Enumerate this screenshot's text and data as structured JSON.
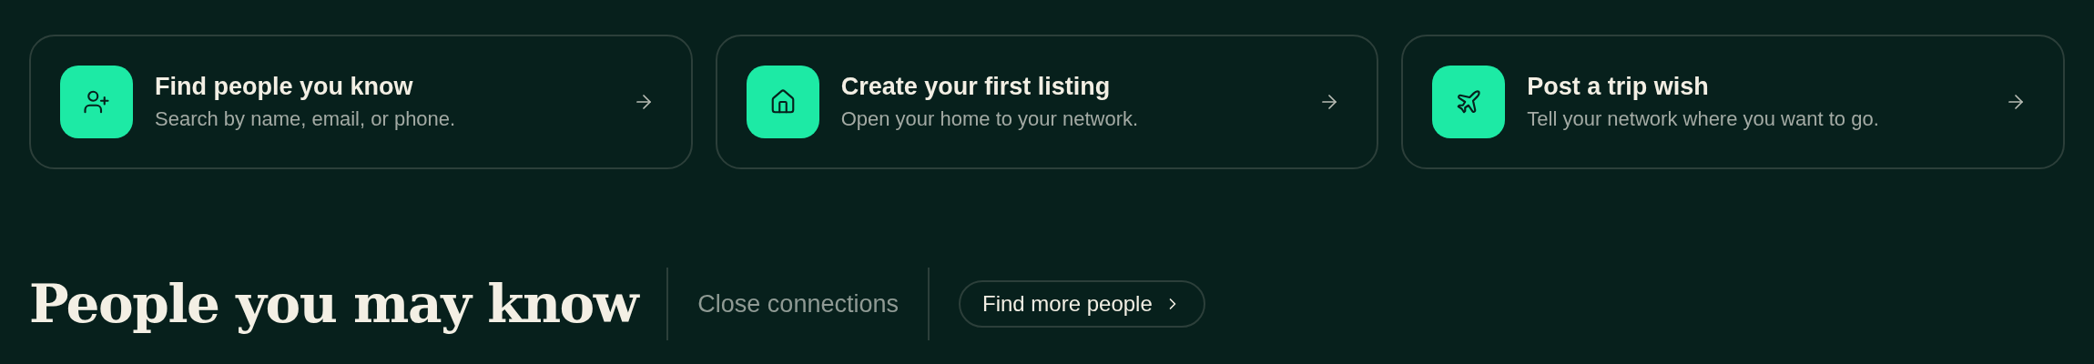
{
  "cards": [
    {
      "kind": "person",
      "title": "Find people you know",
      "subtitle": "Search by name, email, or phone."
    },
    {
      "kind": "home",
      "title": "Create your first listing",
      "subtitle": "Open your home to your network."
    },
    {
      "kind": "plane",
      "title": "Post a trip wish",
      "subtitle": "Tell your network where you want to go."
    }
  ],
  "section": {
    "title": "People you may know",
    "filter": "Close connections",
    "button": "Find more people"
  }
}
